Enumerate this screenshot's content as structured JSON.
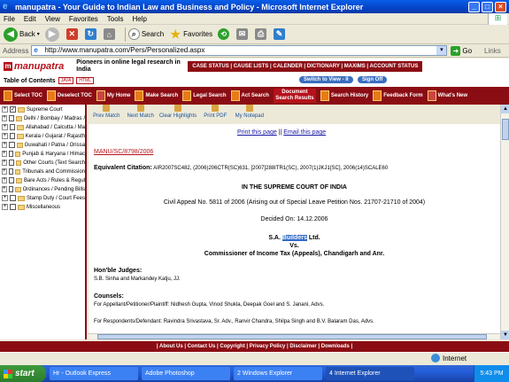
{
  "window": {
    "title": "manupatra - Your Guide to Indian Law and Business and Policy - Microsoft Internet Explorer",
    "minimize": "_",
    "maximize": "□",
    "close": "×"
  },
  "menu": [
    "File",
    "Edit",
    "View",
    "Favorites",
    "Tools",
    "Help"
  ],
  "toolbar": {
    "back": "Back",
    "search": "Search",
    "favorites": "Favorites"
  },
  "address": {
    "label": "Address",
    "url": "http://www.manupatra.com/Pers/Personalized.aspx",
    "go": "Go",
    "links": "Links"
  },
  "site": {
    "brand": "manupatra",
    "tagline": "Pioneers in online legal research in India",
    "topnav": "CASE STATUS | CAUSE LISTS | CALENDER | DICTIONARY | MAXIMS | ACCOUNT STATUS",
    "toc_label": "Table of Contents",
    "badge_java": "JAVA",
    "badge_html": "HTML",
    "switch_view": "Switch to View - II",
    "sign_off": "Sign Off"
  },
  "red_toolbar": [
    "Select TOC",
    "Deselect TOC",
    "My Home",
    "Make Search",
    "Legal Search",
    "Act Search",
    "Document Search Results",
    "Search History",
    "Feedback Form",
    "What's New"
  ],
  "tree": [
    {
      "label": "Supreme Court",
      "checked": true
    },
    {
      "label": "Delhi / Bombay / Madras /",
      "checked": false
    },
    {
      "label": "Allahabad / Calcutta / Ma",
      "checked": false
    },
    {
      "label": "Kerala / Gujarat / Rajasth",
      "checked": false
    },
    {
      "label": "Guwahati / Patna / Orissa",
      "checked": false
    },
    {
      "label": "Punjab & Haryana / Himac",
      "checked": false
    },
    {
      "label": "Other Courts (Text Search",
      "checked": false
    },
    {
      "label": "Tribunals and Commission",
      "checked": false
    },
    {
      "label": "Bare Acts / Rules & Regul",
      "checked": false
    },
    {
      "label": "Ordinances / Pending Bills",
      "checked": false
    },
    {
      "label": "Stamp Duty / Court Fees",
      "checked": false
    },
    {
      "label": "Miscellaneous",
      "checked": false
    }
  ],
  "doc_toolbar": [
    "Prev Match",
    "Next Match",
    "Clear Highlights",
    "Print PDF",
    "My Notepad"
  ],
  "document": {
    "print_link": "Print this page",
    "sep": "||",
    "email_link": "Email this page",
    "cite_id": "MANU/SC/8798/2006",
    "equiv_label": "Equivalent Citation:",
    "equiv_value": " AIR2007SC482, (2006)206CTR(SC)631, [2007]288ITR1(SC), 2007(1)JKJ1[SC], 2006(14)SCALE60",
    "court": "IN THE SUPREME COURT OF INDIA",
    "appeal": "Civil Appeal No. 5811 of 2006 (Arising out of Special Leave Petition Nos. 21707-21710 of 2004)",
    "decided": "Decided On: 14.12.2006",
    "party1_pre": "S.A. ",
    "party1_hl": "Builders",
    "party1_post": " Ltd.",
    "vs": "Vs.",
    "party2": "Commissioner of Income Tax (Appeals), Chandigarh and Anr.",
    "judges_head": "Hon'ble Judges:",
    "judges": "S.B. Sinha and Markandey Katju, JJ.",
    "counsel_head": "Counsels:",
    "counsel_app": "For Appellant/Petitioner/Plaintiff: Nidhesh Gupta, Vinod Shukla, Deepak Goel and S. Janani, Advs.",
    "counsel_resp": "For Respondents/Defendant: Ravindra Srivastava, Sr. Adv., Ranvir Chandra, Shilpa Singh and B.V. Balaram Das, Advs."
  },
  "footer": "| About Us | Contact Us | Copyright | Privacy Policy | Disclaimer | Downloads |",
  "status": {
    "zone": "Internet"
  },
  "taskbar": {
    "start": "start",
    "tasks": [
      "Hr - Outlook Express",
      "Adobe Photoshop",
      "2 Windows Explorer",
      "4 Internet Explorer"
    ],
    "clock": "5:43 PM"
  },
  "colors": {
    "brand_red": "#8b0d14",
    "accent_red": "#b5121b",
    "xp_blue": "#0543c8"
  }
}
